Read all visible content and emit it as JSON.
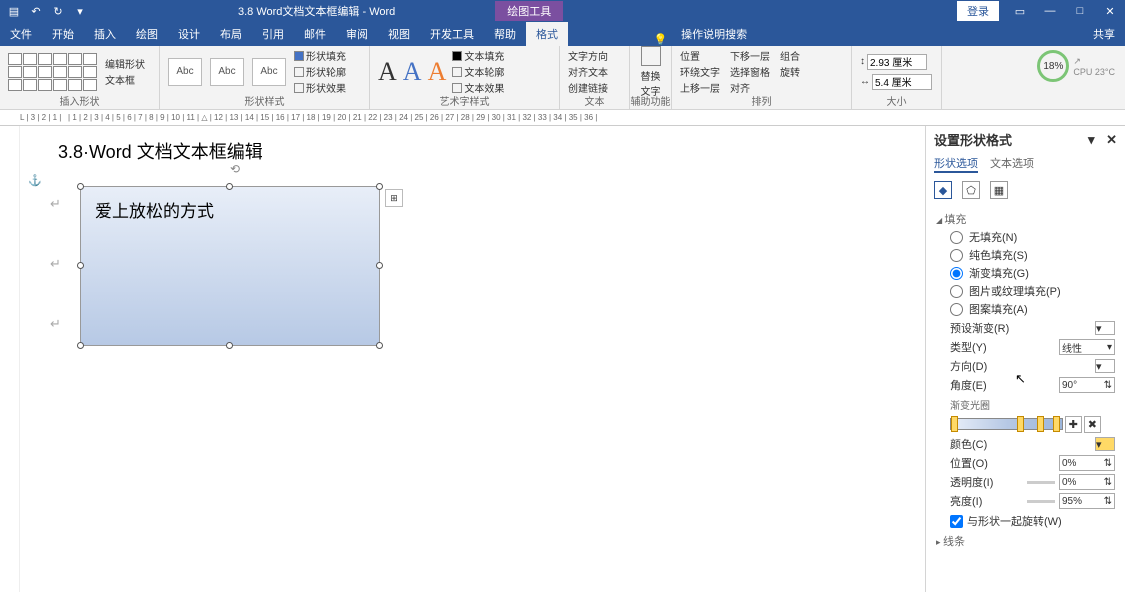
{
  "titlebar": {
    "title": "3.8 Word文档文本框编辑 - Word",
    "context_tab": "绘图工具",
    "login": "登录"
  },
  "tabs": [
    "文件",
    "开始",
    "插入",
    "绘图",
    "设计",
    "布局",
    "引用",
    "邮件",
    "审阅",
    "视图",
    "开发工具",
    "帮助",
    "格式"
  ],
  "active_tab_index": 12,
  "tellme": "操作说明搜索",
  "share": "共享",
  "ribbon": {
    "g1": {
      "label": "插入形状",
      "edit_shape": "编辑形状",
      "textbox": "文本框"
    },
    "g2": {
      "label": "形状样式",
      "abc": "Abc",
      "fill": "形状填充",
      "outline": "形状轮廓",
      "effects": "形状效果"
    },
    "g3": {
      "label": "艺术字样式",
      "textfill": "文本填充",
      "textoutline": "文本轮廓",
      "texteffects": "文本效果"
    },
    "g4": {
      "label": "文本",
      "direction": "文字方向",
      "align": "对齐文本",
      "link": "创建链接"
    },
    "g5": {
      "label": "辅助功能",
      "alt": "替换文字"
    },
    "g6": {
      "label": "排列",
      "pos": "位置",
      "wrap": "环绕文字",
      "forward": "上移一层",
      "backward": "下移一层",
      "pane": "选择窗格",
      "align2": "对齐",
      "group": "组合",
      "rotate": "旋转"
    },
    "g7": {
      "label": "大小",
      "h": "2.93 厘米",
      "w": "5.4 厘米"
    }
  },
  "cpu": {
    "pct": "18%",
    "label": "CPU 23°C"
  },
  "document": {
    "heading": "3.8·Word 文档文本框编辑",
    "textbox_content": "爱上放松的方式"
  },
  "panel": {
    "title": "设置形状格式",
    "tab1": "形状选项",
    "tab2": "文本选项",
    "section_fill": "填充",
    "fill_none": "无填充(N)",
    "fill_solid": "纯色填充(S)",
    "fill_gradient": "渐变填充(G)",
    "fill_picture": "图片或纹理填充(P)",
    "fill_pattern": "图案填充(A)",
    "preset": "预设渐变(R)",
    "type": "类型(Y)",
    "type_val": "线性",
    "direction": "方向(D)",
    "angle": "角度(E)",
    "angle_val": "90°",
    "stops": "渐变光圈",
    "color": "颜色(C)",
    "position": "位置(O)",
    "position_val": "0%",
    "transparency": "透明度(I)",
    "transparency_val": "0%",
    "brightness": "亮度(I)",
    "brightness_val": "95%",
    "rotate_with": "与形状一起旋转(W)",
    "section_line": "线条"
  }
}
